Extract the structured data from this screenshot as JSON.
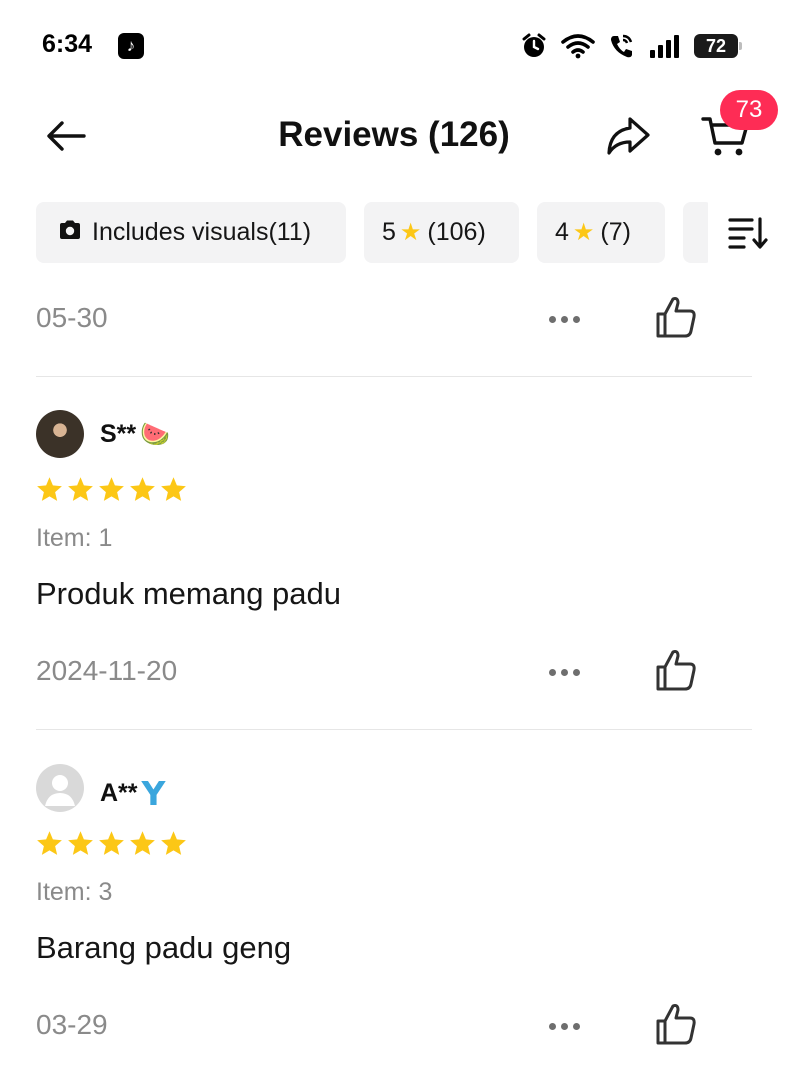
{
  "status_bar": {
    "time": "6:34",
    "app_badge_icon": "tiktok-icon",
    "battery": "72",
    "icons": [
      "alarm-icon",
      "wifi-icon",
      "wifi-call-icon",
      "signal-icon",
      "battery-icon"
    ]
  },
  "header": {
    "title": "Reviews (126)",
    "back_icon": "arrow-left-icon",
    "share_icon": "share-icon",
    "cart_icon": "cart-icon",
    "cart_count": "73"
  },
  "filters": {
    "visuals_label": "Includes visuals(11)",
    "five_star_num": "5",
    "five_star_count": "(106)",
    "four_star_num": "4",
    "four_star_count": "(7)",
    "star_glyph": "★",
    "sort_icon": "sort-icon"
  },
  "top_partial": {
    "date": "05-30"
  },
  "reviews": [
    {
      "name": "S**",
      "name_emoji": "🍉",
      "rating": 5,
      "item": "Item: 1",
      "text": "Produk memang padu",
      "date": "2024-11-20"
    },
    {
      "name": "A**",
      "name_suffix": "Y",
      "rating": 5,
      "item": "Item: 3",
      "text": "Barang padu geng",
      "date": "03-29"
    }
  ],
  "colors": {
    "star": "#FCC716",
    "badge": "#FE2C55",
    "chip_bg": "#F3F3F4",
    "muted_text": "#8A8A8A"
  }
}
